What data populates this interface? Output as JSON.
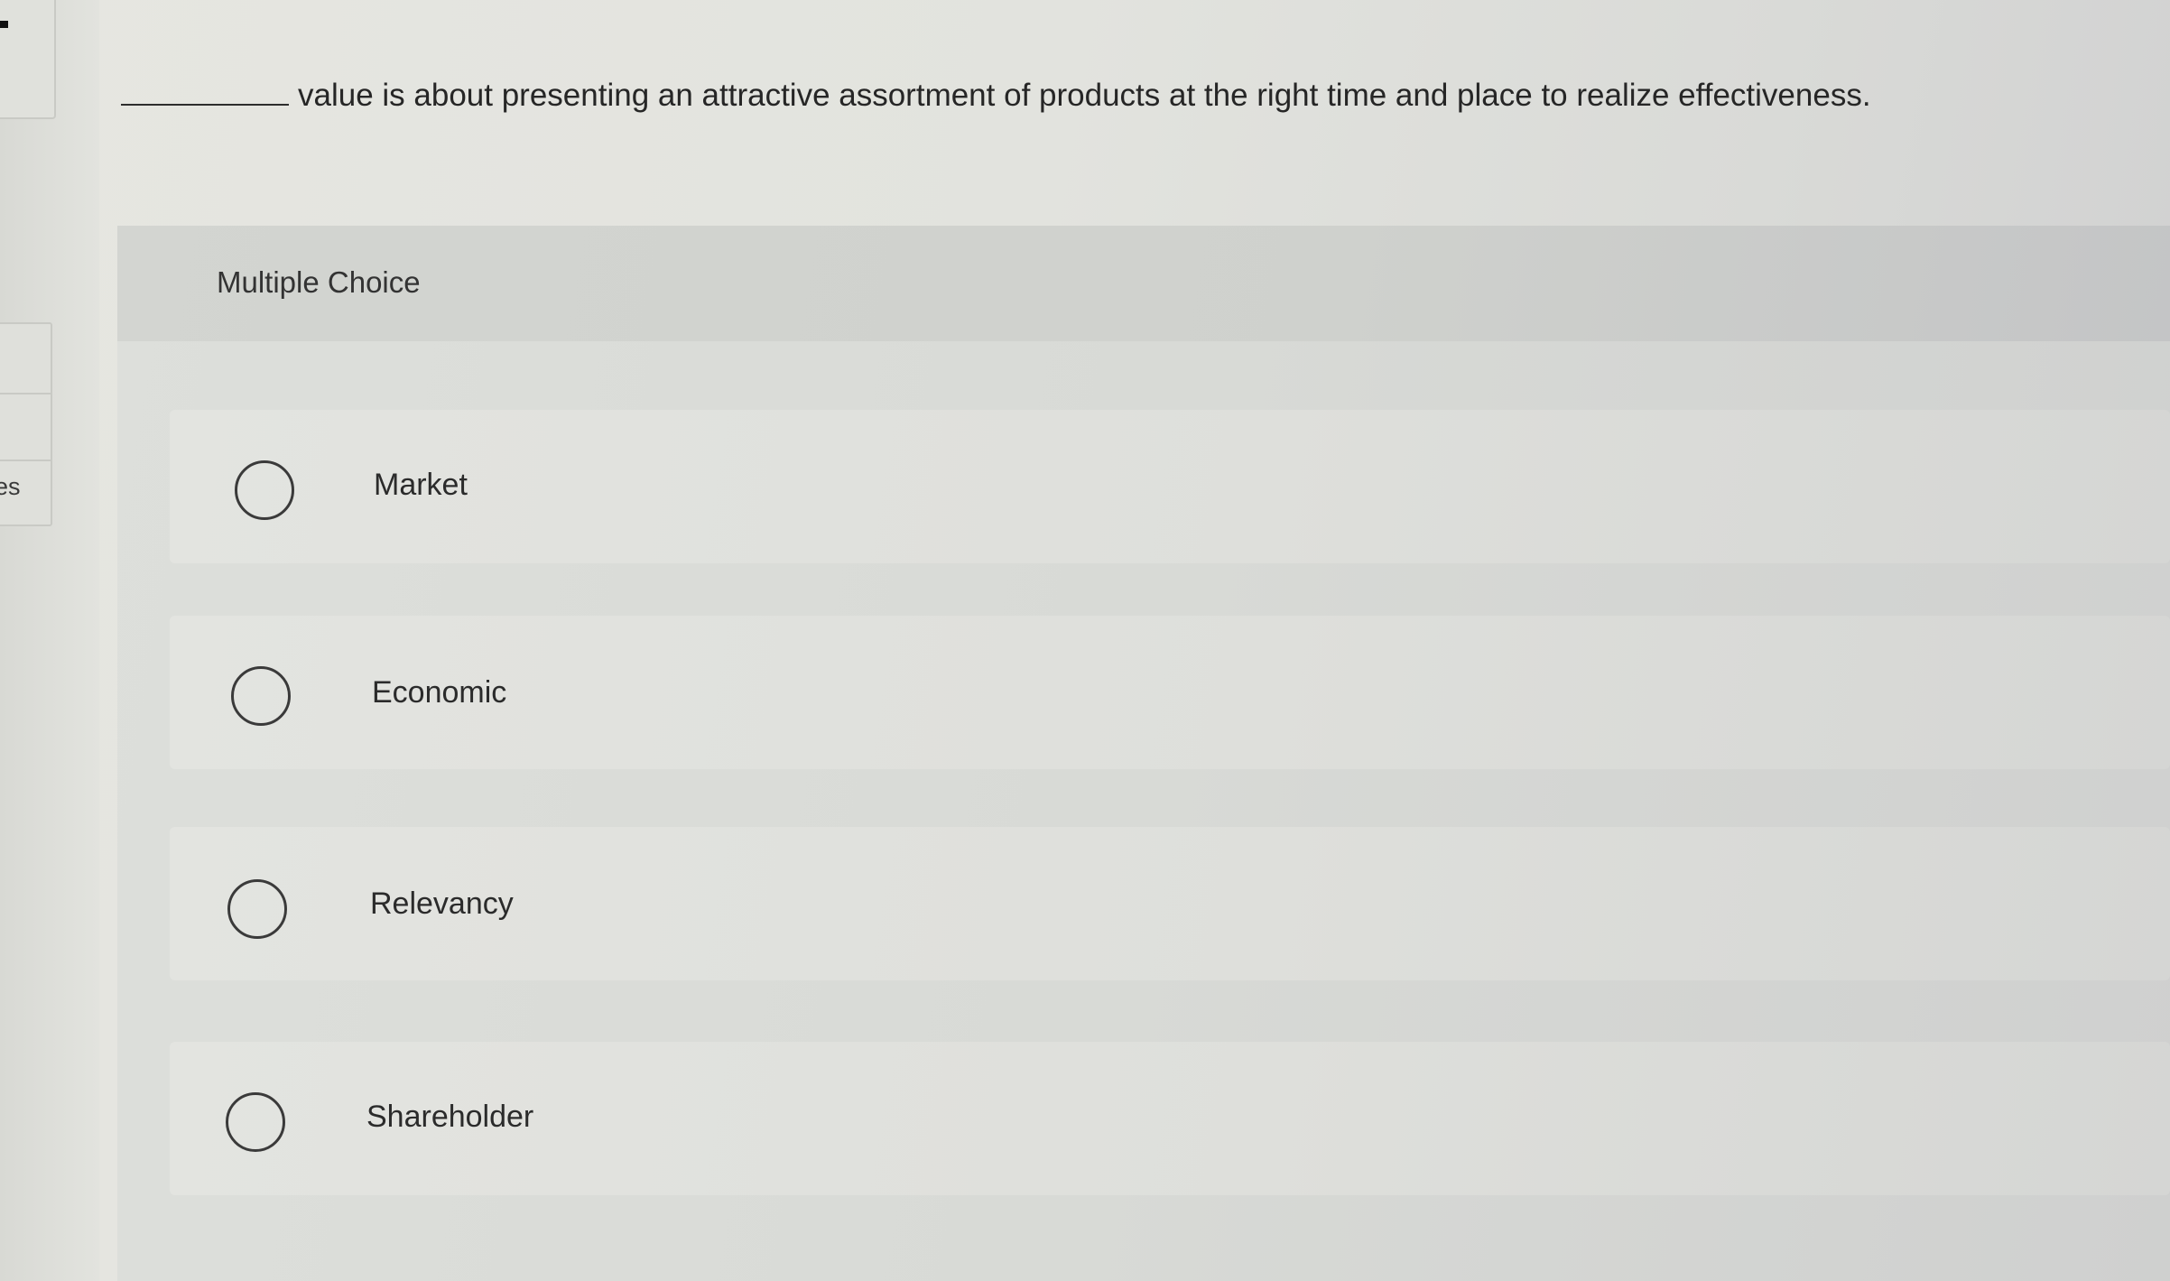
{
  "sidebar": {
    "cut_label": "es"
  },
  "question": {
    "text": "value is about presenting an attractive assortment of products at the right time and place to realize effectiveness."
  },
  "answer_section": {
    "type_label": "Multiple Choice",
    "options": [
      {
        "label": "Market",
        "selected": false
      },
      {
        "label": "Economic",
        "selected": false
      },
      {
        "label": "Relevancy",
        "selected": false
      },
      {
        "label": "Shareholder",
        "selected": false
      }
    ]
  }
}
